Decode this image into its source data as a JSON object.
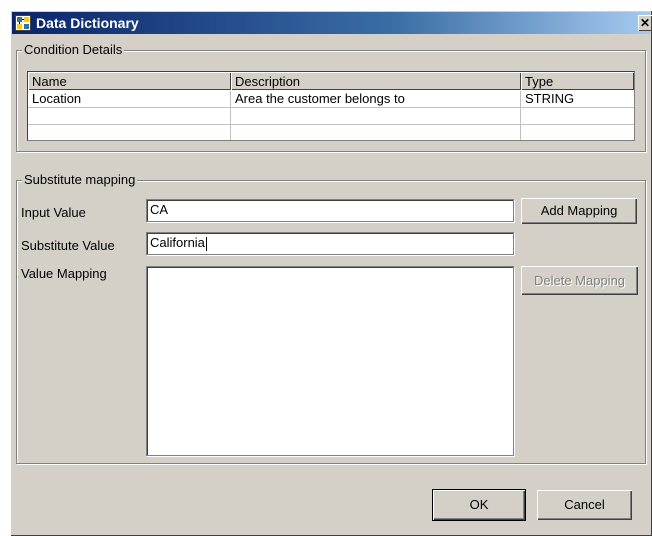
{
  "window": {
    "title": "Data Dictionary",
    "close_glyph": "✕"
  },
  "condition_details": {
    "group_title": "Condition Details",
    "columns": [
      "Name",
      "Description",
      "Type"
    ],
    "rows": [
      [
        "Location",
        "Area the customer belongs to",
        "STRING"
      ],
      [
        "",
        "",
        ""
      ],
      [
        "",
        "",
        ""
      ]
    ]
  },
  "substitute_mapping": {
    "group_title": "Substitute mapping",
    "input_value_label": "Input Value",
    "input_value": "CA",
    "substitute_value_label": "Substitute Value",
    "substitute_value": "California",
    "value_mapping_label": "Value Mapping",
    "value_mapping_items": [],
    "add_mapping_label": "Add Mapping",
    "delete_mapping_label": "Delete Mapping",
    "delete_mapping_enabled": false
  },
  "footer": {
    "ok_label": "OK",
    "cancel_label": "Cancel"
  },
  "colors": {
    "titlebar_start": "#0a246a",
    "titlebar_end": "#a6caf0",
    "dialog_face": "#d4d0c8"
  },
  "icons": {
    "app_icon": "data-dictionary-icon",
    "close_icon": "close-icon"
  }
}
